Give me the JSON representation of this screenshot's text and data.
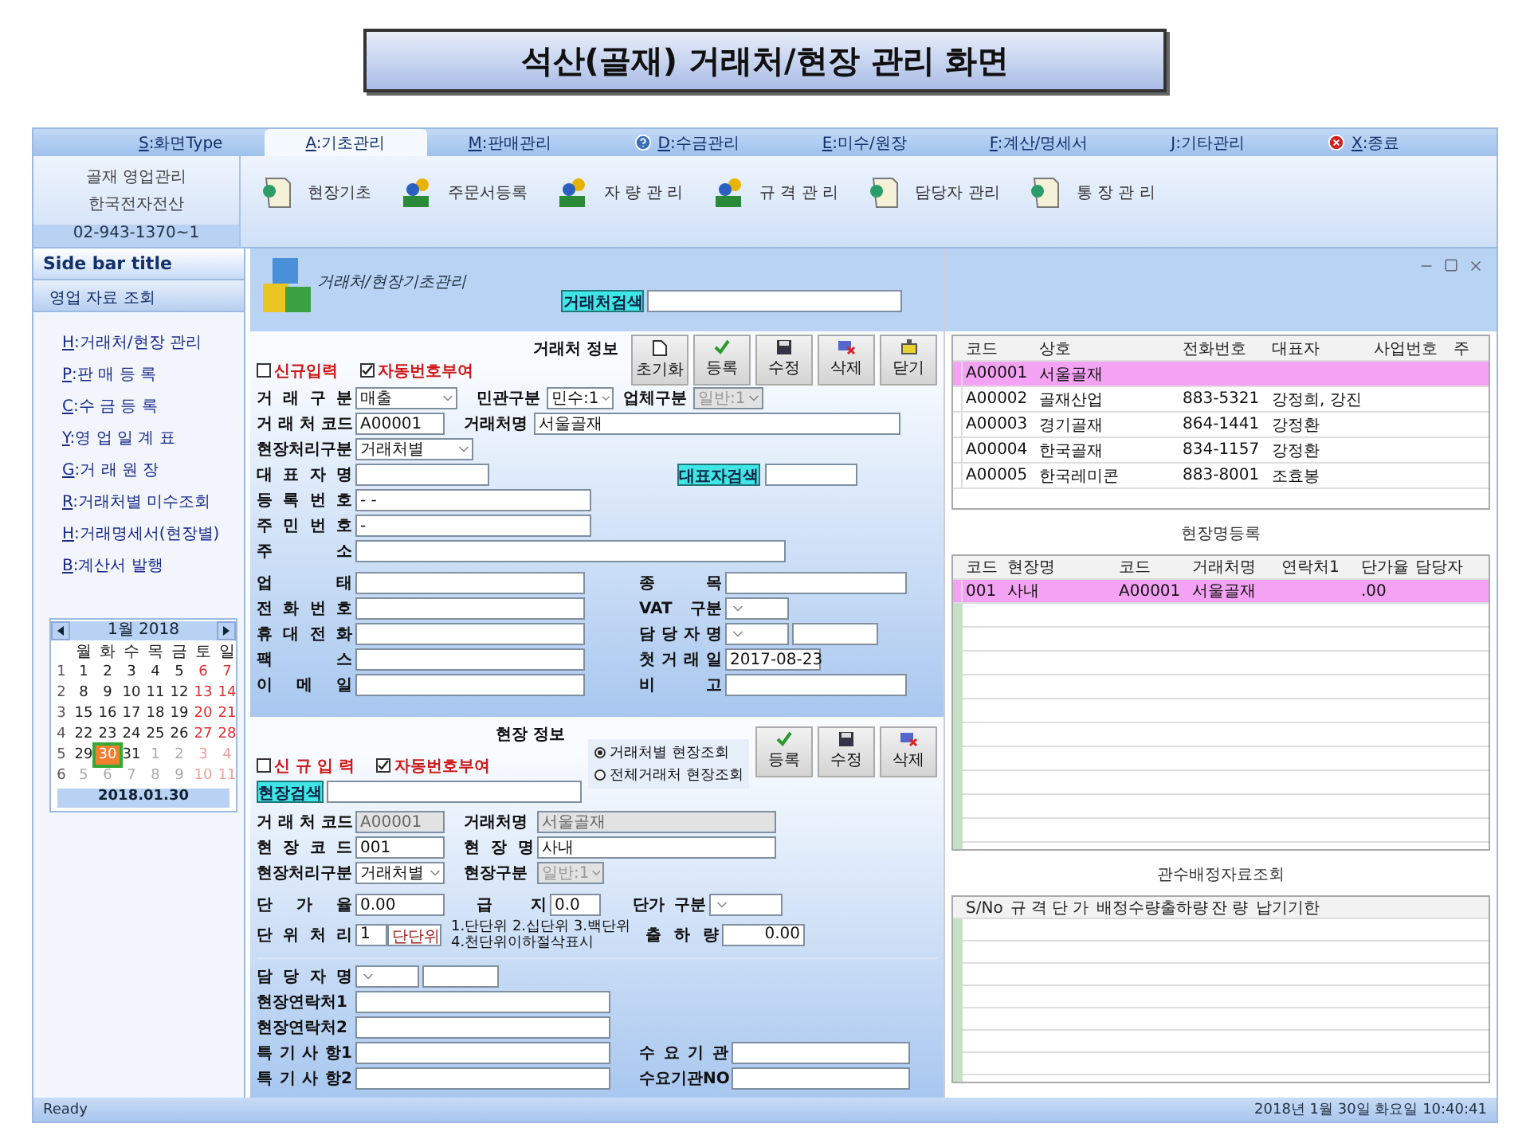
{
  "banner": {
    "title": "석산(골재) 거래처/현장 관리 화면"
  },
  "menu": [
    {
      "label": "S:화면Type",
      "selected": false
    },
    {
      "label": "A:기초관리",
      "selected": true
    },
    {
      "label": "M:판매관리",
      "selected": false
    },
    {
      "label": "D:수금관리",
      "selected": false
    },
    {
      "label": "E:미수/원장",
      "selected": false
    },
    {
      "label": "F:계산/명세서",
      "selected": false
    },
    {
      "label": "J:기타관리",
      "selected": false
    },
    {
      "label": "X:종료",
      "selected": false
    }
  ],
  "ribbon": {
    "info": [
      "골재 영업관리",
      "한국전자전산"
    ],
    "phone": "02-943-1370~1",
    "tools": [
      "현장기초",
      "주문서등록",
      "자 량 관 리",
      "규 격 관 리",
      "담당자 관리",
      "통 장 관 리"
    ]
  },
  "sidebar": {
    "title": "Side bar title",
    "group": "영업 자료 조회",
    "items": [
      "H:거래처/현장 관리",
      "P:판 매 등 록",
      "C:수 금 등 록",
      "Y:영 업 일 계 표",
      "G:거 래 원 장",
      "R:거래처별 미수조회",
      "H:거래명세서(현장별)",
      "B:계산서 발행"
    ],
    "calendar": {
      "month": "1월 2018",
      "weekdays": [
        "월",
        "화",
        "수",
        "목",
        "금",
        "토",
        "일"
      ],
      "weeks": [
        {
          "num": "1",
          "days": [
            {
              "d": "1",
              "kind": "day",
              "selected": false
            },
            {
              "d": "2",
              "kind": "day",
              "selected": false
            },
            {
              "d": "3",
              "kind": "day",
              "selected": false
            },
            {
              "d": "4",
              "kind": "day",
              "selected": false
            },
            {
              "d": "5",
              "kind": "day",
              "selected": false
            },
            {
              "d": "6",
              "kind": "weekend",
              "selected": false
            },
            {
              "d": "7",
              "kind": "weekend",
              "selected": false
            }
          ]
        },
        {
          "num": "2",
          "days": [
            {
              "d": "8",
              "kind": "day",
              "selected": false
            },
            {
              "d": "9",
              "kind": "day",
              "selected": false
            },
            {
              "d": "10",
              "kind": "day",
              "selected": false
            },
            {
              "d": "11",
              "kind": "day",
              "selected": false
            },
            {
              "d": "12",
              "kind": "day",
              "selected": false
            },
            {
              "d": "13",
              "kind": "weekend",
              "selected": false
            },
            {
              "d": "14",
              "kind": "weekend",
              "selected": false
            }
          ]
        },
        {
          "num": "3",
          "days": [
            {
              "d": "15",
              "kind": "day",
              "selected": false
            },
            {
              "d": "16",
              "kind": "day",
              "selected": false
            },
            {
              "d": "17",
              "kind": "day",
              "selected": false
            },
            {
              "d": "18",
              "kind": "day",
              "selected": false
            },
            {
              "d": "19",
              "kind": "day",
              "selected": false
            },
            {
              "d": "20",
              "kind": "weekend",
              "selected": false
            },
            {
              "d": "21",
              "kind": "weekend",
              "selected": false
            }
          ]
        },
        {
          "num": "4",
          "days": [
            {
              "d": "22",
              "kind": "day",
              "selected": false
            },
            {
              "d": "23",
              "kind": "day",
              "selected": false
            },
            {
              "d": "24",
              "kind": "day",
              "selected": false
            },
            {
              "d": "25",
              "kind": "day",
              "selected": false
            },
            {
              "d": "26",
              "kind": "day",
              "selected": false
            },
            {
              "d": "27",
              "kind": "weekend",
              "selected": false
            },
            {
              "d": "28",
              "kind": "weekend",
              "selected": false
            }
          ]
        },
        {
          "num": "5",
          "days": [
            {
              "d": "29",
              "kind": "day",
              "selected": false
            },
            {
              "d": "30",
              "kind": "day",
              "selected": true
            },
            {
              "d": "31",
              "kind": "day",
              "selected": false
            },
            {
              "d": "1",
              "kind": "other",
              "selected": false
            },
            {
              "d": "2",
              "kind": "other",
              "selected": false
            },
            {
              "d": "3",
              "kind": "other_weekend",
              "selected": false
            },
            {
              "d": "4",
              "kind": "other_weekend",
              "selected": false
            }
          ]
        },
        {
          "num": "6",
          "days": [
            {
              "d": "5",
              "kind": "other",
              "selected": false
            },
            {
              "d": "6",
              "kind": "other",
              "selected": false
            },
            {
              "d": "7",
              "kind": "other",
              "selected": false
            },
            {
              "d": "8",
              "kind": "other",
              "selected": false
            },
            {
              "d": "9",
              "kind": "other",
              "selected": false
            },
            {
              "d": "10",
              "kind": "other_weekend",
              "selected": false
            },
            {
              "d": "11",
              "kind": "other_weekend",
              "selected": false
            }
          ]
        }
      ],
      "footer": "2018.01.30"
    }
  },
  "header": {
    "title": "거래처/현장기초관리",
    "search": {
      "label": "거래처검색"
    }
  },
  "client": {
    "title": "거래처 정보",
    "checks": [
      {
        "label": "신규입력",
        "checked": false
      },
      {
        "label": "자동번호부여",
        "checked": true
      }
    ],
    "buttons": [
      "초기화",
      "등록",
      "수정",
      "삭제",
      "닫기"
    ],
    "rows": [
      [
        {
          "label": "거 래 구 분",
          "value": "매출",
          "kind": "select"
        },
        {
          "label": "민관구분",
          "value": "민수:1",
          "kind": "select"
        },
        {
          "label": "업체구분",
          "value": "일반:1",
          "kind": "select",
          "disabled": true
        }
      ],
      [
        {
          "label": "거 래 처 코드",
          "value": "A00001",
          "kind": "text"
        },
        {
          "label": "거래처명",
          "value": "서울골재",
          "kind": "text"
        }
      ],
      [
        {
          "label": "현장처리구분",
          "value": "거래처별",
          "kind": "select"
        }
      ],
      [
        {
          "label": "대 표 자 명",
          "kind": "text"
        },
        {
          "label": "대표자검색",
          "kind": "search"
        }
      ],
      [
        {
          "label": "등 록 번 호",
          "value": "- -",
          "kind": "text"
        }
      ],
      [
        {
          "label": "주 민 번 호",
          "value": "-",
          "kind": "text"
        }
      ],
      [
        {
          "label": "주 소",
          "kind": "text"
        }
      ],
      [
        {
          "label": "업 태",
          "kind": "text"
        },
        {
          "label": "종 목",
          "kind": "text"
        }
      ],
      [
        {
          "label": "전 화 번 호",
          "kind": "text"
        },
        {
          "label": "VAT 구분",
          "kind": "select"
        }
      ],
      [
        {
          "label": "휴 대 전 화",
          "kind": "text"
        },
        {
          "label": "담 당 자 명",
          "kind": "select_text"
        }
      ],
      [
        {
          "label": "팩 스",
          "kind": "text"
        },
        {
          "label": "첫 거 래 일",
          "value": "2017-08-23",
          "kind": "date"
        }
      ],
      [
        {
          "label": "이 메 일",
          "kind": "text"
        },
        {
          "label": "비 고",
          "kind": "text"
        }
      ]
    ]
  },
  "site": {
    "title": "현장 정보",
    "checks": [
      {
        "label": "신 규 입 력",
        "checked": false
      },
      {
        "label": "자동번호부여",
        "checked": true
      }
    ],
    "search": {
      "label": "현장검색"
    },
    "radios": [
      {
        "label": "거래처별 현장조회",
        "selected": true
      },
      {
        "label": "전체거래처 현장조회",
        "selected": false
      }
    ],
    "buttons": [
      "등록",
      "수정",
      "삭제"
    ],
    "rows": [
      [
        {
          "label": "거 래 처 코드",
          "value": "A00001",
          "kind": "text",
          "disabled": true
        },
        {
          "label": "거래처명",
          "value": "서울골재",
          "kind": "text",
          "disabled": true
        }
      ],
      [
        {
          "label": "현 장 코 드",
          "value": "001",
          "kind": "text"
        },
        {
          "label": "현 장 명",
          "value": "사내",
          "kind": "text"
        }
      ],
      [
        {
          "label": "현장처리구분",
          "value": "거래처별",
          "kind": "select"
        },
        {
          "label": "현장구분",
          "value": "일반:1",
          "kind": "select",
          "disabled": true
        }
      ],
      [
        {
          "label": "단 가 율",
          "value": "0.00",
          "kind": "text"
        },
        {
          "label": "급 지",
          "value": "0.0",
          "kind": "text"
        },
        {
          "label": "단가 구분",
          "kind": "select"
        }
      ],
      [
        {
          "label": "단 위 처 리",
          "value": "1",
          "unit": "단단위",
          "kind": "unit"
        },
        {
          "lines": [
            "1.단단위 2.십단위 3.백단위",
            "4.천단위이하절삭표시"
          ],
          "kind": "note"
        },
        {
          "label": "출 하 량",
          "value": "0.00",
          "kind": "number"
        }
      ],
      [
        {
          "label": "담 당 자 명",
          "kind": "select_text"
        }
      ],
      [
        {
          "label": "현장연락처1",
          "kind": "text"
        }
      ],
      [
        {
          "label": "현장연락처2",
          "kind": "text"
        }
      ],
      [
        {
          "label": "특 기 사 항1",
          "kind": "text"
        },
        {
          "label": "수 요 기 관",
          "kind": "text"
        }
      ],
      [
        {
          "label": "특 기 사 항2",
          "kind": "text"
        },
        {
          "label": "수요기관NO",
          "kind": "text"
        }
      ]
    ]
  },
  "clients_table": {
    "columns": [
      "코드",
      "상호",
      "전화번호",
      "대표자",
      "사업번호",
      "주"
    ],
    "rows": [
      {
        "cells": [
          "A00001",
          "서울골재",
          "",
          "",
          "",
          ""
        ],
        "selected": true
      },
      {
        "cells": [
          "A00002",
          "골재산업",
          "883-5321",
          "강정희, 강진",
          "",
          ""
        ],
        "selected": false
      },
      {
        "cells": [
          "A00003",
          "경기골재",
          "864-1441",
          "강정환",
          "",
          ""
        ],
        "selected": false
      },
      {
        "cells": [
          "A00004",
          "한국골재",
          "834-1157",
          "강정환",
          "",
          ""
        ],
        "selected": false
      },
      {
        "cells": [
          "A00005",
          "한국레미콘",
          "883-8001",
          "조효봉",
          "",
          ""
        ],
        "selected": false
      }
    ]
  },
  "sites_title": "현장명등록",
  "sites_table": {
    "columns": [
      "코드",
      "현장명",
      "코드",
      "거래처명",
      "연락처1",
      "단가율",
      "담당자"
    ],
    "rows": [
      {
        "cells": [
          "001",
          "사내",
          "A00001",
          "서울골재",
          "",
          ".00",
          ""
        ],
        "selected": true
      }
    ]
  },
  "alloc_title": "관수배정자료조회",
  "alloc_table": {
    "columns": [
      "S/No",
      "규 격",
      "단 가",
      "배정수량",
      "출하량",
      "잔 량",
      "납기기한"
    ]
  },
  "status_bar": {
    "left": "Ready",
    "right": "2018년 1월 30일 화요일 10:40:41"
  }
}
